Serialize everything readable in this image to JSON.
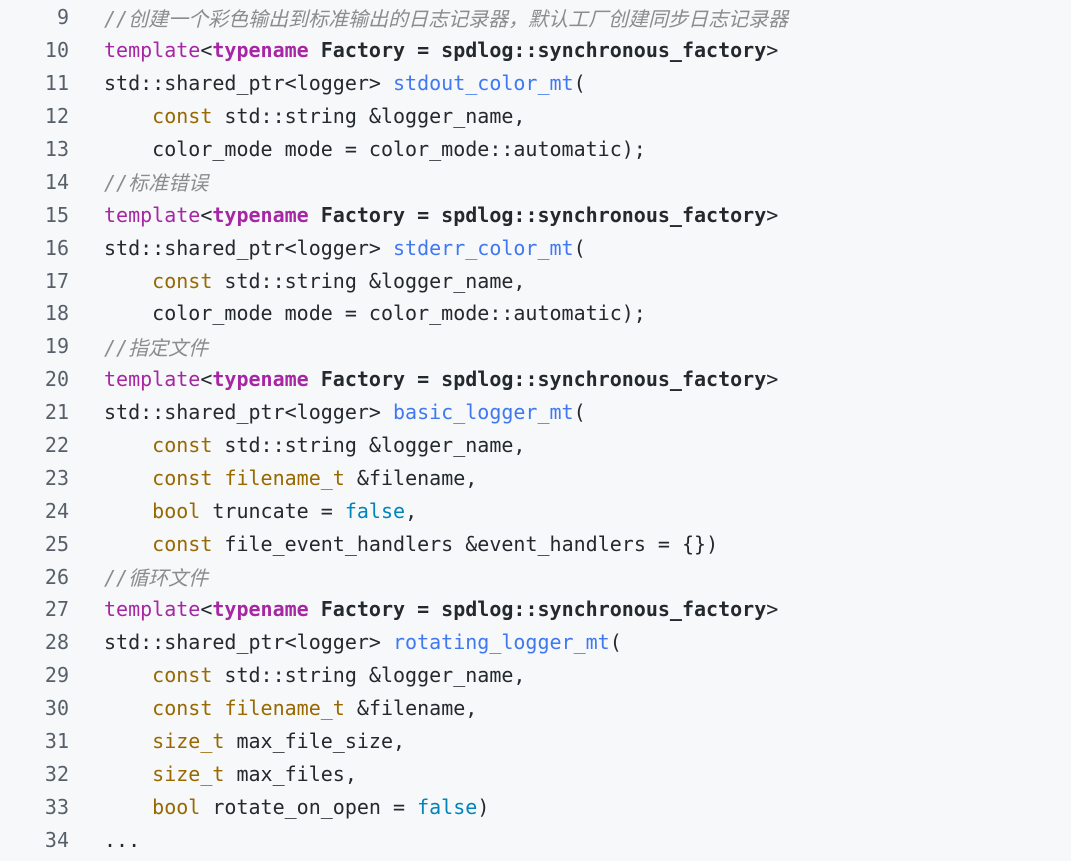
{
  "colors": {
    "background": "#f6f8fa",
    "comment": "#8c8c8c",
    "keyword": "#a626a4",
    "type": "#986801",
    "function": "#4078f2",
    "literal": "#0184bc",
    "plain": "#24292e",
    "line_number": "#57606a"
  },
  "lines": [
    {
      "num": "9",
      "tokens": [
        {
          "t": "comment",
          "v": "//创建一个彩色输出到标准输出的日志记录器，默认工厂创建同步日志记录器"
        }
      ]
    },
    {
      "num": "10",
      "tokens": [
        {
          "t": "kw",
          "v": "template"
        },
        {
          "t": "op",
          "v": "<"
        },
        {
          "t": "kwb",
          "v": "typename"
        },
        {
          "t": "bold",
          "v": " Factory = spdlog::synchronous_factory"
        },
        {
          "t": "op",
          "v": ">"
        }
      ]
    },
    {
      "num": "11",
      "tokens": [
        {
          "t": "plain",
          "v": "std::shared_ptr<logger> "
        },
        {
          "t": "fn",
          "v": "stdout_color_mt"
        },
        {
          "t": "plain",
          "v": "("
        }
      ]
    },
    {
      "num": "12",
      "tokens": [
        {
          "t": "plain",
          "v": "    "
        },
        {
          "t": "type",
          "v": "const"
        },
        {
          "t": "plain",
          "v": " std::string &logger_name,"
        }
      ]
    },
    {
      "num": "13",
      "tokens": [
        {
          "t": "plain",
          "v": "    color_mode mode = color_mode::automatic);"
        }
      ]
    },
    {
      "num": "14",
      "tokens": [
        {
          "t": "comment",
          "v": "//标准错误"
        }
      ]
    },
    {
      "num": "15",
      "tokens": [
        {
          "t": "kw",
          "v": "template"
        },
        {
          "t": "op",
          "v": "<"
        },
        {
          "t": "kwb",
          "v": "typename"
        },
        {
          "t": "bold",
          "v": " Factory = spdlog::synchronous_factory"
        },
        {
          "t": "op",
          "v": ">"
        }
      ]
    },
    {
      "num": "16",
      "tokens": [
        {
          "t": "plain",
          "v": "std::shared_ptr<logger> "
        },
        {
          "t": "fn",
          "v": "stderr_color_mt"
        },
        {
          "t": "plain",
          "v": "("
        }
      ]
    },
    {
      "num": "17",
      "tokens": [
        {
          "t": "plain",
          "v": "    "
        },
        {
          "t": "type",
          "v": "const"
        },
        {
          "t": "plain",
          "v": " std::string &logger_name,"
        }
      ]
    },
    {
      "num": "18",
      "tokens": [
        {
          "t": "plain",
          "v": "    color_mode mode = color_mode::automatic);"
        }
      ]
    },
    {
      "num": "19",
      "tokens": [
        {
          "t": "comment",
          "v": "//指定文件"
        }
      ]
    },
    {
      "num": "20",
      "tokens": [
        {
          "t": "kw",
          "v": "template"
        },
        {
          "t": "op",
          "v": "<"
        },
        {
          "t": "kwb",
          "v": "typename"
        },
        {
          "t": "bold",
          "v": " Factory = spdlog::synchronous_factory"
        },
        {
          "t": "op",
          "v": ">"
        }
      ]
    },
    {
      "num": "21",
      "tokens": [
        {
          "t": "plain",
          "v": "std::shared_ptr<logger> "
        },
        {
          "t": "fn",
          "v": "basic_logger_mt"
        },
        {
          "t": "plain",
          "v": "("
        }
      ]
    },
    {
      "num": "22",
      "tokens": [
        {
          "t": "plain",
          "v": "    "
        },
        {
          "t": "type",
          "v": "const"
        },
        {
          "t": "plain",
          "v": " std::string &logger_name,"
        }
      ]
    },
    {
      "num": "23",
      "tokens": [
        {
          "t": "plain",
          "v": "    "
        },
        {
          "t": "type",
          "v": "const"
        },
        {
          "t": "plain",
          "v": " "
        },
        {
          "t": "type",
          "v": "filename_t"
        },
        {
          "t": "plain",
          "v": " &filename,"
        }
      ]
    },
    {
      "num": "24",
      "tokens": [
        {
          "t": "plain",
          "v": "    "
        },
        {
          "t": "type",
          "v": "bool"
        },
        {
          "t": "plain",
          "v": " truncate = "
        },
        {
          "t": "lit",
          "v": "false"
        },
        {
          "t": "plain",
          "v": ","
        }
      ]
    },
    {
      "num": "25",
      "tokens": [
        {
          "t": "plain",
          "v": "    "
        },
        {
          "t": "type",
          "v": "const"
        },
        {
          "t": "plain",
          "v": " file_event_handlers &event_handlers = {})"
        }
      ]
    },
    {
      "num": "26",
      "tokens": [
        {
          "t": "comment",
          "v": "//循环文件"
        }
      ]
    },
    {
      "num": "27",
      "tokens": [
        {
          "t": "kw",
          "v": "template"
        },
        {
          "t": "op",
          "v": "<"
        },
        {
          "t": "kwb",
          "v": "typename"
        },
        {
          "t": "bold",
          "v": " Factory = spdlog::synchronous_factory"
        },
        {
          "t": "op",
          "v": ">"
        }
      ]
    },
    {
      "num": "28",
      "tokens": [
        {
          "t": "plain",
          "v": "std::shared_ptr<logger> "
        },
        {
          "t": "fn",
          "v": "rotating_logger_mt"
        },
        {
          "t": "plain",
          "v": "("
        }
      ]
    },
    {
      "num": "29",
      "tokens": [
        {
          "t": "plain",
          "v": "    "
        },
        {
          "t": "type",
          "v": "const"
        },
        {
          "t": "plain",
          "v": " std::string &logger_name,"
        }
      ]
    },
    {
      "num": "30",
      "tokens": [
        {
          "t": "plain",
          "v": "    "
        },
        {
          "t": "type",
          "v": "const"
        },
        {
          "t": "plain",
          "v": " "
        },
        {
          "t": "type",
          "v": "filename_t"
        },
        {
          "t": "plain",
          "v": " &filename,"
        }
      ]
    },
    {
      "num": "31",
      "tokens": [
        {
          "t": "plain",
          "v": "    "
        },
        {
          "t": "type",
          "v": "size_t"
        },
        {
          "t": "plain",
          "v": " max_file_size,"
        }
      ]
    },
    {
      "num": "32",
      "tokens": [
        {
          "t": "plain",
          "v": "    "
        },
        {
          "t": "type",
          "v": "size_t"
        },
        {
          "t": "plain",
          "v": " max_files,"
        }
      ]
    },
    {
      "num": "33",
      "tokens": [
        {
          "t": "plain",
          "v": "    "
        },
        {
          "t": "type",
          "v": "bool"
        },
        {
          "t": "plain",
          "v": " rotate_on_open = "
        },
        {
          "t": "lit",
          "v": "false"
        },
        {
          "t": "plain",
          "v": ")"
        }
      ]
    },
    {
      "num": "34",
      "tokens": [
        {
          "t": "plain",
          "v": "..."
        }
      ]
    }
  ]
}
